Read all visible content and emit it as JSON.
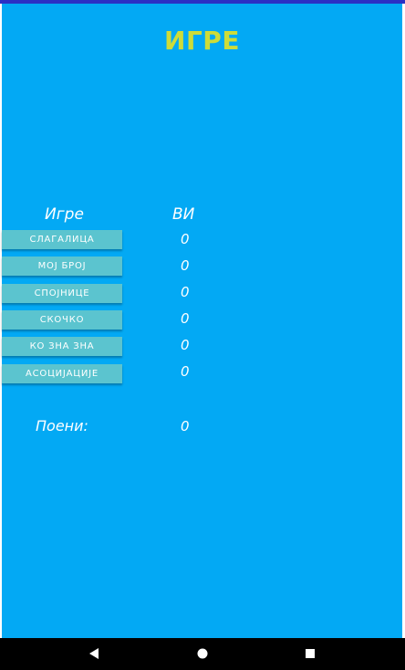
{
  "header": {
    "title": "ИГРЕ"
  },
  "columns": {
    "games_label": "Игре",
    "you_label": "ВИ"
  },
  "games": [
    {
      "label": "СЛАГАЛИЦА",
      "score": "0"
    },
    {
      "label": "МОЈ БРОЈ",
      "score": "0"
    },
    {
      "label": "СПОЈНИЦЕ",
      "score": "0"
    },
    {
      "label": "СКОЧКО",
      "score": "0"
    },
    {
      "label": "КО ЗНА ЗНА",
      "score": "0"
    },
    {
      "label": "АСОЦИЈАЦИЈЕ",
      "score": "0"
    }
  ],
  "total": {
    "label": "Поени:",
    "value": "0"
  },
  "colors": {
    "background": "#03a9f4",
    "title": "#cddc39",
    "button": "#5bc4cf",
    "status_strip": "#2b2fc4",
    "nav_bar": "#000000"
  },
  "navigation": {
    "back_icon": "back-triangle-icon",
    "home_icon": "home-circle-icon",
    "recent_icon": "recent-square-icon"
  }
}
